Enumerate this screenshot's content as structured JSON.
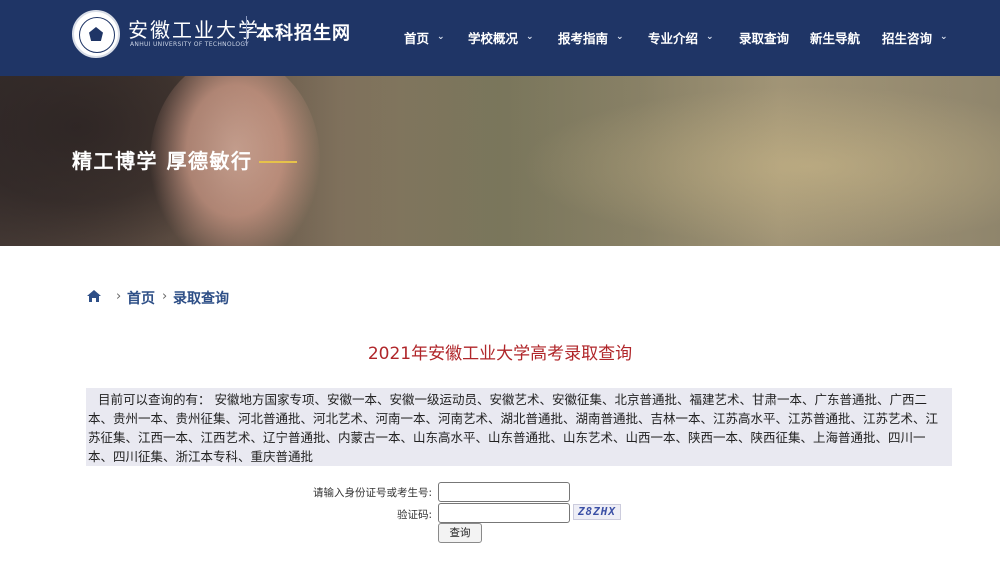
{
  "header": {
    "school_name_cn": "安徽工业大学",
    "school_name_en": "ANHUI UNIVERSITY OF TECHNOLOGY",
    "site_title": "本科招生网",
    "nav": [
      {
        "label": "首页",
        "has_dropdown": true
      },
      {
        "label": "学校概况",
        "has_dropdown": true
      },
      {
        "label": "报考指南",
        "has_dropdown": true
      },
      {
        "label": "专业介绍",
        "has_dropdown": true
      },
      {
        "label": "录取查询",
        "has_dropdown": false
      },
      {
        "label": "新生导航",
        "has_dropdown": false
      },
      {
        "label": "招生咨询",
        "has_dropdown": true
      }
    ],
    "chevron": "⌄"
  },
  "banner": {
    "motto": "精工博学 厚德敏行"
  },
  "breadcrumb": {
    "icon": "home-icon",
    "separator": "›",
    "items": [
      "首页",
      "录取查询"
    ]
  },
  "main": {
    "title": "2021年安徽工业大学高考录取查询",
    "notice": "目前可以查询的有：  安徽地方国家专项、安徽一本、安徽一级运动员、安徽艺术、安徽征集、北京普通批、福建艺术、甘肃一本、广东普通批、广西二本、贵州一本、贵州征集、河北普通批、河北艺术、河南一本、河南艺术、湖北普通批、湖南普通批、吉林一本、江苏高水平、江苏普通批、江苏艺术、江苏征集、江西一本、江西艺术、辽宁普通批、内蒙古一本、山东高水平、山东普通批、山东艺术、山西一本、陕西一本、陕西征集、上海普通批、四川一本、四川征集、浙江本专科、重庆普通批",
    "form": {
      "id_label": "请输入身份证号或考生号:",
      "id_value": "",
      "captcha_label": "验证码:",
      "captcha_value": "",
      "captcha_text": "Z8ZHX",
      "submit_label": "查询"
    }
  },
  "colors": {
    "header_bg": "#1f3566",
    "title_red": "#b0262a",
    "link_blue": "#2e4f87",
    "notice_bg": "#e9e9f1",
    "motto_underline": "#e6c24a"
  }
}
